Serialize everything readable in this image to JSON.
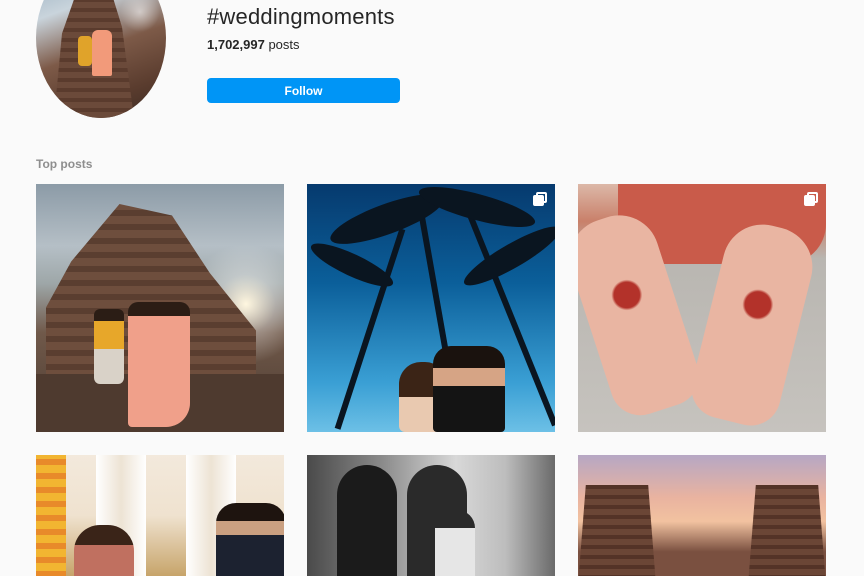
{
  "header": {
    "hashtag": "#weddingmoments",
    "post_count_value": "1,702,997",
    "post_count_suffix": " posts",
    "follow_label": "Follow"
  },
  "section": {
    "label": "Top posts"
  },
  "posts": [
    {
      "multi": false
    },
    {
      "multi": true
    },
    {
      "multi": true
    },
    {
      "multi": false
    },
    {
      "multi": false
    },
    {
      "multi": false
    }
  ],
  "colors": {
    "accent": "#0095f6",
    "background": "#fafafa",
    "muted_text": "#8e8e8e"
  },
  "icons": {
    "multi_post": "carousel-icon"
  }
}
